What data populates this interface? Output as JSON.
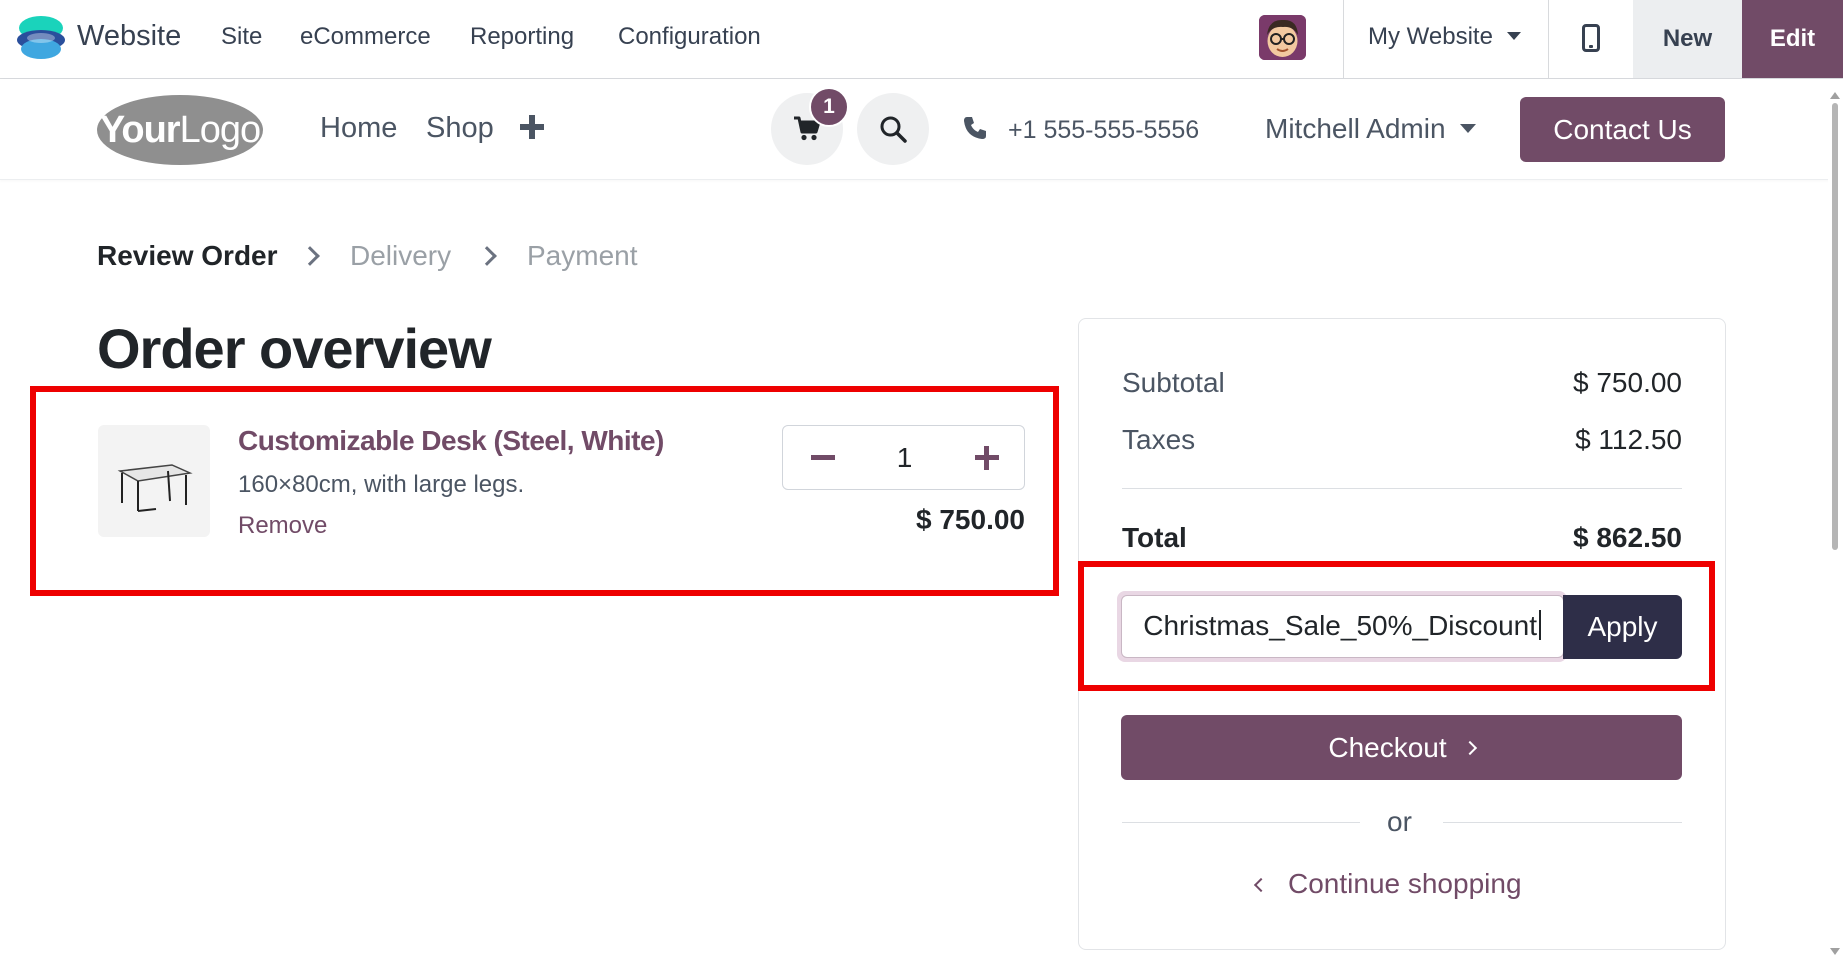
{
  "topbar": {
    "app_name": "Website",
    "menu": [
      "Site",
      "eCommerce",
      "Reporting",
      "Configuration"
    ],
    "website_selector": "My Website",
    "new_label": "New",
    "edit_label": "Edit"
  },
  "header": {
    "logo_bold": "Your",
    "logo_light": "Logo",
    "nav": [
      "Home",
      "Shop"
    ],
    "cart_count": "1",
    "phone": "+1 555-555-5556",
    "user": "Mitchell Admin",
    "contact_label": "Contact Us"
  },
  "steps": [
    "Review Order",
    "Delivery",
    "Payment"
  ],
  "page_title": "Order overview",
  "cart_line": {
    "product_name": "Customizable Desk (Steel, White)",
    "description": "160×80cm, with large legs.",
    "remove_label": "Remove",
    "quantity": "1",
    "price": "$ 750.00"
  },
  "summary": {
    "subtotal_label": "Subtotal",
    "subtotal_value": "$ 750.00",
    "taxes_label": "Taxes",
    "taxes_value": "$ 112.50",
    "total_label": "Total",
    "total_value": "$ 862.50",
    "promo_code_value": "Christmas_Sale_50%_Discount",
    "apply_label": "Apply",
    "checkout_label": "Checkout",
    "or_label": "or",
    "continue_label": "Continue shopping"
  },
  "colors": {
    "brand": "#714b67",
    "highlight": "#ee0000",
    "apply": "#2e2e48"
  }
}
